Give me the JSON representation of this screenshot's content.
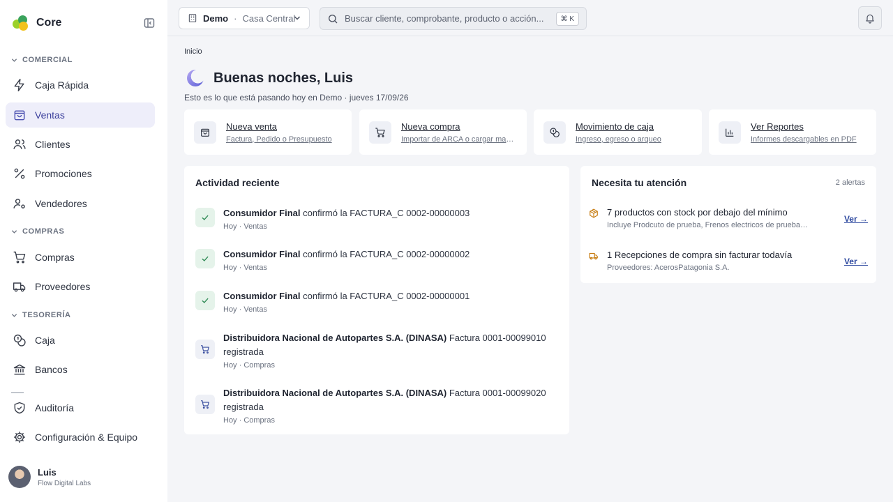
{
  "app": {
    "name": "Core"
  },
  "sidebar": {
    "sections": [
      {
        "label": "COMERCIAL"
      },
      {
        "label": "COMPRAS"
      },
      {
        "label": "TESORERÍA"
      }
    ],
    "items": [
      {
        "label": "Caja Rápida",
        "icon": "bolt-icon"
      },
      {
        "label": "Ventas",
        "icon": "bag-icon",
        "active": true
      },
      {
        "label": "Clientes",
        "icon": "users-icon"
      },
      {
        "label": "Promociones",
        "icon": "percent-icon"
      },
      {
        "label": "Vendedores",
        "icon": "user-cog-icon"
      },
      {
        "label": "Compras",
        "icon": "cart-icon"
      },
      {
        "label": "Proveedores",
        "icon": "truck-icon"
      },
      {
        "label": "Caja",
        "icon": "coins-icon"
      },
      {
        "label": "Bancos",
        "icon": "bank-icon"
      },
      {
        "label": "Auditoría",
        "icon": "shield-icon"
      },
      {
        "label": "Configuración & Equipo",
        "icon": "gear-icon"
      }
    ],
    "user": {
      "name": "Luis",
      "org": "Flow Digital Labs"
    }
  },
  "topbar": {
    "branch": {
      "company": "Demo",
      "separator": "·",
      "location": "Casa Central"
    },
    "search": {
      "placeholder": "Buscar cliente, comprobante, producto o acción...",
      "shortcut": "⌘ K"
    }
  },
  "main": {
    "breadcrumb": "Inicio",
    "greeting": "Buenas noches, Luis",
    "subtitle": "Esto es lo que está pasando hoy en Demo · jueves 17/09/26",
    "quick_actions": [
      {
        "title": "Nueva venta",
        "subtitle": "Factura, Pedido o Presupuesto",
        "icon": "bag-icon"
      },
      {
        "title": "Nueva compra",
        "subtitle": "Importar de ARCA o cargar manual",
        "icon": "cart-icon"
      },
      {
        "title": "Movimiento de caja",
        "subtitle": "Ingreso, egreso o arqueo",
        "icon": "coins-icon"
      },
      {
        "title": "Ver Reportes",
        "subtitle": "Informes descargables en PDF",
        "icon": "chart-icon"
      }
    ],
    "activity": {
      "title": "Actividad reciente",
      "items": [
        {
          "actor": "Consumidor Final",
          "text": " confirmó la FACTURA_C 0002-00000003",
          "meta": "Hoy · Ventas",
          "icon": "check-icon"
        },
        {
          "actor": "Consumidor Final",
          "text": " confirmó la FACTURA_C 0002-00000002",
          "meta": "Hoy · Ventas",
          "icon": "check-icon"
        },
        {
          "actor": "Consumidor Final",
          "text": " confirmó la FACTURA_C 0002-00000001",
          "meta": "Hoy · Ventas",
          "icon": "check-icon"
        },
        {
          "actor": "Distribuidora Nacional de Autopartes S.A. (DINASA)",
          "text": " Factura 0001-00099010 registrada",
          "meta": "Hoy · Compras",
          "icon": "cart-icon"
        },
        {
          "actor": "Distribuidora Nacional de Autopartes S.A. (DINASA)",
          "text": " Factura 0001-00099020 registrada",
          "meta": "Hoy · Compras",
          "icon": "cart-icon"
        }
      ]
    },
    "attention": {
      "title": "Necesita tu atención",
      "count": "2 alertas",
      "items": [
        {
          "title": "7 productos con stock por debajo del mínimo",
          "subtitle": "Incluye Prodcuto de prueba, Frenos electricos de prueba, Cubiertas",
          "link": "Ver →",
          "icon": "box-icon",
          "color": "#c77d12"
        },
        {
          "title": "1 Recepciones de compra sin facturar todavía",
          "subtitle": "Proveedores: AcerosPatagonia S.A.",
          "link": "Ver →",
          "icon": "truck-icon",
          "color": "#c77d12"
        }
      ]
    }
  },
  "colors": {
    "accent": "#3b3f9c",
    "active_bg": "#eeeefa",
    "success": "#2f8a55",
    "warning": "#c77d12",
    "link": "#2f4aa0"
  }
}
